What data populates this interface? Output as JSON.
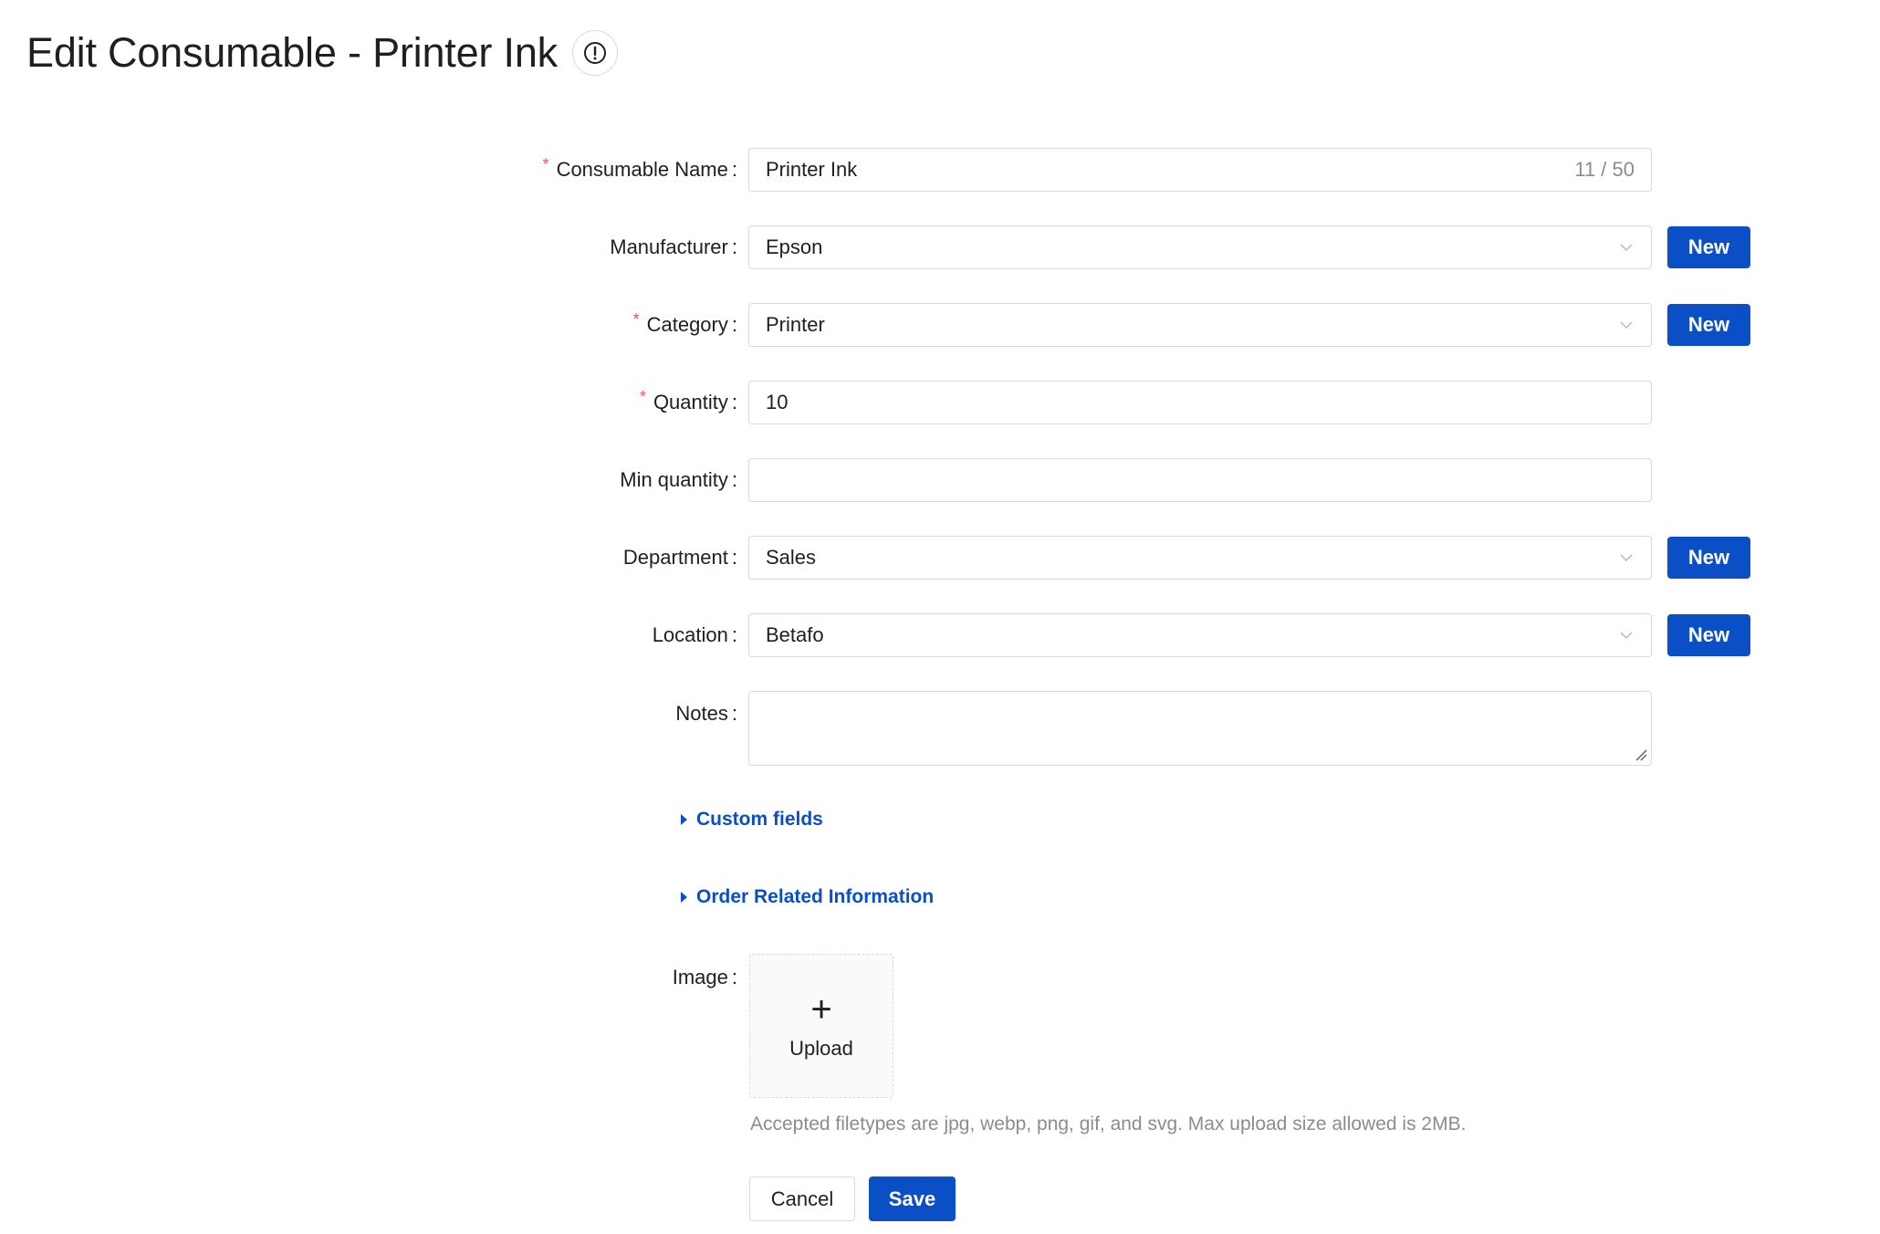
{
  "header": {
    "title": "Edit Consumable - Printer Ink",
    "info_icon": "exclamation-circle-icon"
  },
  "form": {
    "name": {
      "label": "Consumable Name",
      "value": "Printer Ink",
      "counter": "11 / 50",
      "required": true
    },
    "manufacturer": {
      "label": "Manufacturer",
      "value": "Epson",
      "new_label": "New"
    },
    "category": {
      "label": "Category",
      "value": "Printer",
      "new_label": "New",
      "required": true
    },
    "quantity": {
      "label": "Quantity",
      "value": "10",
      "required": true
    },
    "min_quantity": {
      "label": "Min quantity",
      "value": ""
    },
    "department": {
      "label": "Department",
      "value": "Sales",
      "new_label": "New"
    },
    "location": {
      "label": "Location",
      "value": "Betafo",
      "new_label": "New"
    },
    "notes": {
      "label": "Notes",
      "value": ""
    },
    "custom_fields": {
      "label": "Custom fields"
    },
    "order_info": {
      "label": "Order Related Information"
    },
    "image": {
      "label": "Image",
      "upload_label": "Upload",
      "hint": "Accepted filetypes are jpg, webp, png, gif, and svg. Max upload size allowed is 2MB."
    },
    "colon": ":",
    "required_mark": "*"
  },
  "actions": {
    "cancel_label": "Cancel",
    "save_label": "Save"
  },
  "colors": {
    "primary": "#0b4fc7",
    "required": "#ff4d4f",
    "border": "#d9d9d9",
    "muted": "#8c8c8c"
  }
}
